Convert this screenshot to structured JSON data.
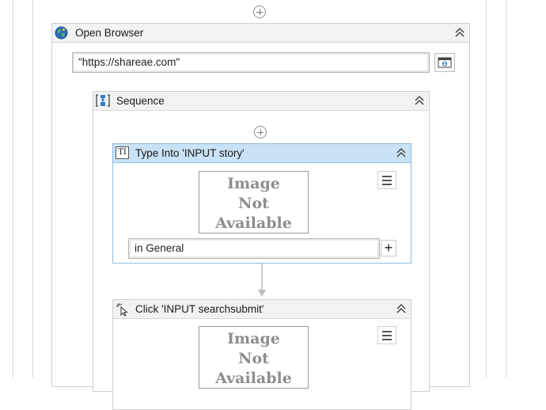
{
  "open_browser": {
    "title": "Open Browser",
    "url_value": "\"https://shareae.com\""
  },
  "sequence": {
    "title": "Sequence"
  },
  "type_into": {
    "title": "Type Into 'INPUT  story'",
    "image_placeholder": [
      "Image",
      "Not",
      "Available"
    ],
    "text_value": "in  General"
  },
  "click": {
    "title": "Click 'INPUT  searchsubmit'",
    "image_placeholder": [
      "Image",
      "Not",
      "Available"
    ]
  },
  "icons": {
    "open_browser": "globe-icon",
    "sequence": "sequence-icon",
    "type_into": "type-into-icon",
    "click": "click-icon",
    "collapse": "double-chevron-up-icon",
    "add": "add-activity-icon",
    "menu": "hamburger-menu-icon",
    "browser_window": "browser-window-icon"
  },
  "colors": {
    "selected_header": "#c9e2f5",
    "selected_border": "#8fbde6",
    "header": "#f1f2f4"
  }
}
